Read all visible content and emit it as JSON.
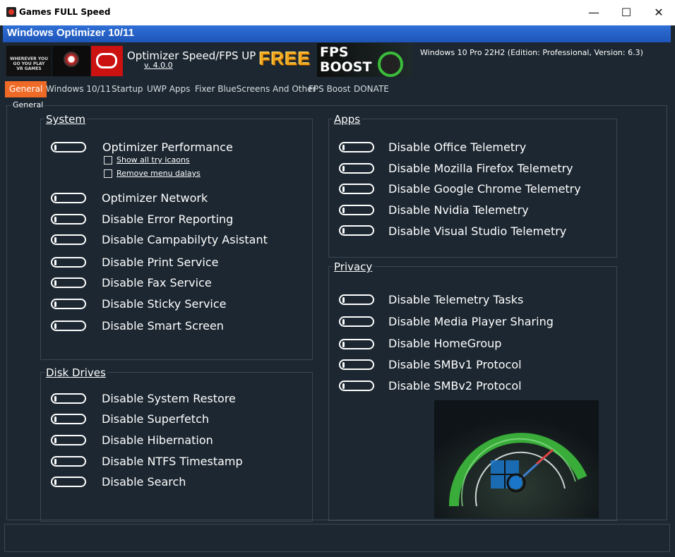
{
  "window": {
    "title": "Games FULL Speed",
    "controls": {
      "minimize": "—",
      "maximize": "☐",
      "close": "✕"
    }
  },
  "header": {
    "title": "Windows Optimizer 10/11"
  },
  "banner": {
    "vr_text": "WHEREVER YOU GO YOU PLAY VR GAMES",
    "product": "Optimizer Speed/FPS  UP",
    "version": "v. 4.0.0",
    "free": "FREE",
    "fps_boost": "FPS BOOST",
    "os_info": "Windows 10 Pro 22H2 (Edition: Professional, Version: 6.3)"
  },
  "tabs": [
    "General",
    "Windows 10/11",
    "Startup",
    "UWP Apps",
    "Fixer BlueScreens And Other",
    "FPS Boost",
    "DONATE"
  ],
  "general": {
    "legend": "General",
    "system": {
      "title": "System",
      "items": [
        "Optimizer Performance",
        "Optimizer Network",
        "Disable Error Reporting",
        "Disable Campabilyty Asistant",
        "Disable Print Service",
        "Disable Fax Service",
        "Disable Sticky Service",
        "Disable Smart Screen"
      ],
      "sub_checks": [
        "Show all try icaons",
        "Remove menu dalays"
      ]
    },
    "disk": {
      "title": "Disk Drives",
      "items": [
        "Disable System Restore",
        "Disable Superfetch",
        "Disable Hibernation",
        "Disable NTFS Timestamp",
        "Disable Search"
      ]
    },
    "apps": {
      "title": "Apps",
      "items": [
        "Disable Office Telemetry",
        "Disable Mozilla Firefox Telemetry",
        "Disable Google Chrome Telemetry",
        "Disable Nvidia Telemetry",
        "Disable Visual Studio Telemetry"
      ]
    },
    "privacy": {
      "title": "Privacy",
      "items": [
        "Disable Telemetry Tasks",
        "Disable Media Player Sharing",
        "Disable HomeGroup",
        "Disable SMBv1 Protocol",
        "Disable SMBv2 Protocol"
      ]
    }
  },
  "colors": {
    "background": "#1c2731",
    "header_band": "#2f6fd6",
    "active_tab": "#ef6a26",
    "free": "#f2a81c"
  }
}
